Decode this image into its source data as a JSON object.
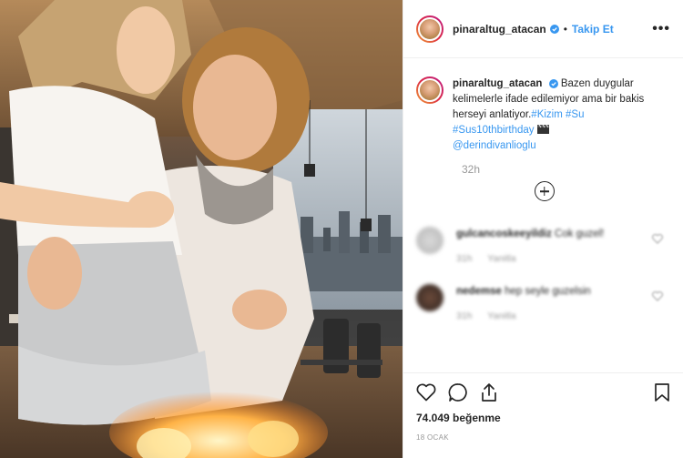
{
  "post": {
    "username": "pinaraltug_atacan",
    "follow_label": "Takip Et",
    "separator": "•",
    "more_label": "•••",
    "caption": {
      "username": "pinaraltug_atacan",
      "text": "Bazen duygular kelimelerle ifade edilemiyor ama bir bakis herseyi anlatiyor.",
      "hashtag1": "#Kizim",
      "hashtag2": "#Su",
      "hashtag3": "#Sus10thbirthday",
      "mention": "@derindivanlioglu"
    },
    "time_ago": "32h",
    "likes": "74.049 beğenme",
    "date": "18 OCAK"
  },
  "comments": [
    {
      "username": "gulcancoskeeyildiz",
      "text": "Cok guzel!",
      "time": "31h",
      "reply_label": "Yanitla"
    },
    {
      "username": "nedemse",
      "text": "hep seyle guzelsin",
      "time": "31h",
      "reply_label": "Yanitla"
    }
  ],
  "icons": {
    "like": "heart-icon",
    "comment": "comment-icon",
    "share": "share-icon",
    "save": "bookmark-icon",
    "add_comment": "plus-circle-icon",
    "verified": "verified-badge-icon",
    "clapper": "clapperboard-icon"
  },
  "colors": {
    "link_blue": "#3897f0",
    "text": "#262626",
    "muted": "#999999",
    "border": "#efefef"
  }
}
